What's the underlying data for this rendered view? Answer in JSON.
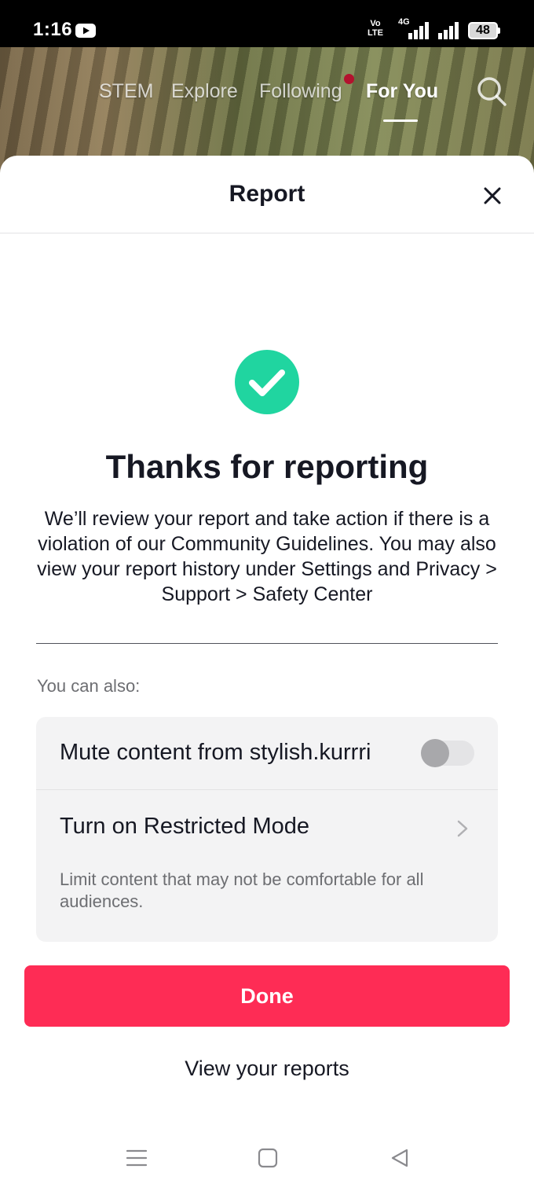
{
  "status_bar": {
    "time": "1:16",
    "volte_line1": "Vo",
    "volte_line2": "LTE",
    "network": "4G",
    "battery": "48"
  },
  "top_nav": {
    "tabs": [
      {
        "label": "STEM"
      },
      {
        "label": "Explore"
      },
      {
        "label": "Following"
      },
      {
        "label": "For You"
      }
    ],
    "active_tab": "For You",
    "notification_dot_color": "#b3122e"
  },
  "sheet": {
    "title": "Report",
    "heading": "Thanks for reporting",
    "body": "We’ll review your report and take action if there is a violation of our Community Guidelines. You may also view your report history under Settings and Privacy > Support > Safety Center",
    "also_label": "You can also:",
    "options": {
      "mute": {
        "label": "Mute content from stylish.kurrri",
        "toggle_on": false
      },
      "restricted": {
        "label": "Turn on Restricted Mode",
        "description": "Limit content that may not be comfortable for all audiences."
      }
    },
    "done_label": "Done",
    "view_reports_label": "View your reports"
  },
  "colors": {
    "accent": "#fe2c55",
    "success": "#20d5a0",
    "text_primary": "#161823",
    "text_secondary": "#6d6e72",
    "card_bg": "#f3f3f4"
  },
  "icons": {
    "close": "close-icon",
    "success": "check-circle-icon",
    "search": "search-icon",
    "chevron": "chevron-right-icon"
  }
}
